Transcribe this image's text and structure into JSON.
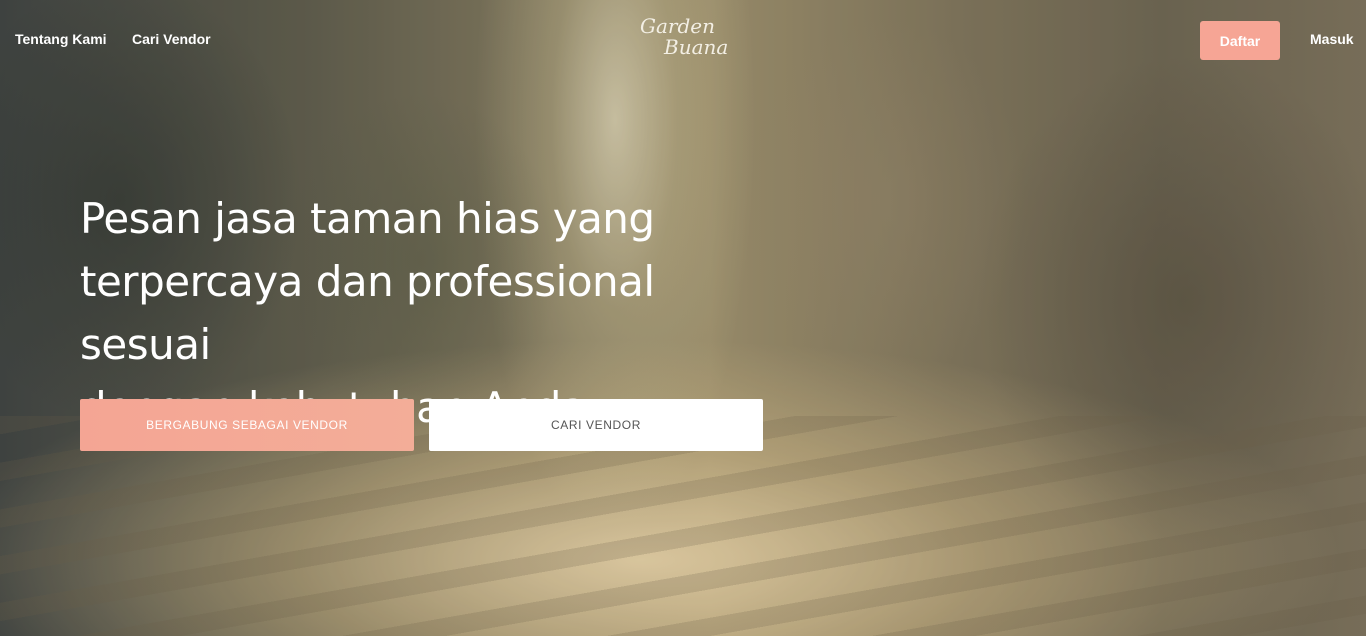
{
  "nav": {
    "left_links": [
      "Tentang Kami",
      "Cari Vendor"
    ],
    "logo": {
      "line1": "Garden",
      "line2": "Buana"
    },
    "signup_label": "Daftar",
    "login_label": "Masuk"
  },
  "hero": {
    "headline_lines": [
      "Pesan jasa taman hias yang",
      "terpercaya dan professional sesuai",
      "dengan kebutuhan Anda"
    ],
    "primary_cta": "BERGABUNG SEBAGAI VENDOR",
    "secondary_cta": "CARI VENDOR"
  },
  "colors": {
    "accent": "#f6a595",
    "text_light": "#ffffff",
    "secondary_button_bg": "#ffffff",
    "secondary_button_text": "#555555"
  }
}
